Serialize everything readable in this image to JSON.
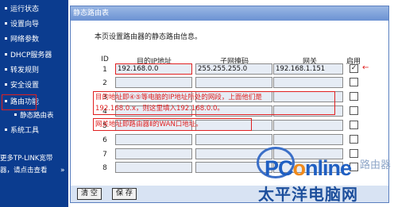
{
  "sidebar": {
    "items": [
      {
        "label": "运行状态"
      },
      {
        "label": "设置向导"
      },
      {
        "label": "网络参数"
      },
      {
        "label": "DHCP服务器"
      },
      {
        "label": "转发规则"
      },
      {
        "label": "安全设置"
      },
      {
        "label": "路由功能"
      },
      {
        "label": "静态路由表"
      },
      {
        "label": "系统工具"
      }
    ],
    "promo_line1": "更多TP-LINK宽带",
    "promo_line2": "器，请点击查看",
    "promo_arrow": "»"
  },
  "panel": {
    "title": "静态路由表",
    "description": "本页设置路由器的静态路由信息。",
    "columns": {
      "id": "ID",
      "dest": "目的IP地址",
      "mask": "子网掩码",
      "gateway": "网关",
      "enabled": "启用"
    },
    "rows": [
      {
        "id": "1",
        "dest": "192.168.0.0",
        "mask": "255.255.255.0",
        "gateway": "192.168.1.151",
        "checked": "✓"
      },
      {
        "id": "2",
        "dest": "",
        "mask": "",
        "gateway": "",
        "checked": ""
      },
      {
        "id": "3",
        "dest": "",
        "mask": "",
        "gateway": "",
        "checked": ""
      },
      {
        "id": "4",
        "dest": "",
        "mask": "",
        "gateway": "",
        "checked": ""
      },
      {
        "id": "5",
        "dest": "",
        "mask": "",
        "gateway": "",
        "checked": ""
      },
      {
        "id": "6",
        "dest": "",
        "mask": "",
        "gateway": "",
        "checked": ""
      },
      {
        "id": "7",
        "dest": "",
        "mask": "",
        "gateway": "",
        "checked": ""
      },
      {
        "id": "8",
        "dest": "",
        "mask": "",
        "gateway": "",
        "checked": ""
      }
    ],
    "annotation_arrow": "←",
    "note1_line1": "目的地址即④⑤等电脑的IP地址所处的网段，上面他们是",
    "note1_line2": "192.168.0.x，则这里填入192.168.0.0。",
    "note2": "网关地址即路由器Ⅱ的WAN口地址。",
    "buttons": {
      "clear": "清 空",
      "save": "保 存"
    }
  },
  "watermark": {
    "brand_pc": "PC",
    "brand_o": "o",
    "brand_rest": "nline",
    "cn": "太平洋电脑网",
    "right_text": "路由器"
  },
  "colors": {
    "sidebar_bg": "#0b3c8f",
    "header_bg": "#6b92d3",
    "annotation": "#e02020",
    "watermark_blue": "#1f5fc2",
    "watermark_orange": "#f08a1c"
  }
}
